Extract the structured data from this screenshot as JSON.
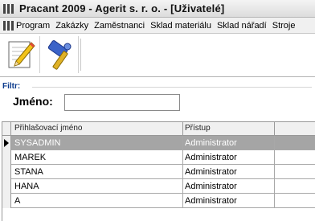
{
  "window": {
    "title": "Pracant 2009 - Agerit s. r. o. - [Uživatelé]"
  },
  "menu": {
    "items": [
      "Program",
      "Zakázky",
      "Zaměstnanci",
      "Sklad materiálu",
      "Sklad nářadí",
      "Stroje"
    ]
  },
  "toolbar": {
    "buttons": [
      {
        "icon": "edit-icon"
      },
      {
        "icon": "hammer-icon"
      }
    ]
  },
  "filter": {
    "title": "Filtr:",
    "name_label": "Jméno:",
    "name_value": ""
  },
  "grid": {
    "columns": [
      "Přihlašovací jméno",
      "Přístup"
    ],
    "rows": [
      {
        "login": "SYSADMIN",
        "access": "Administrator",
        "selected": true
      },
      {
        "login": "MAREK",
        "access": "Administrator",
        "selected": false
      },
      {
        "login": "STANA",
        "access": "Administrator",
        "selected": false
      },
      {
        "login": "HANA",
        "access": "Administrator",
        "selected": false
      },
      {
        "login": "A",
        "access": "Administrator",
        "selected": false
      }
    ]
  },
  "colors": {
    "selection": "#a5a5a5",
    "filter_title": "#0a3a8c"
  }
}
